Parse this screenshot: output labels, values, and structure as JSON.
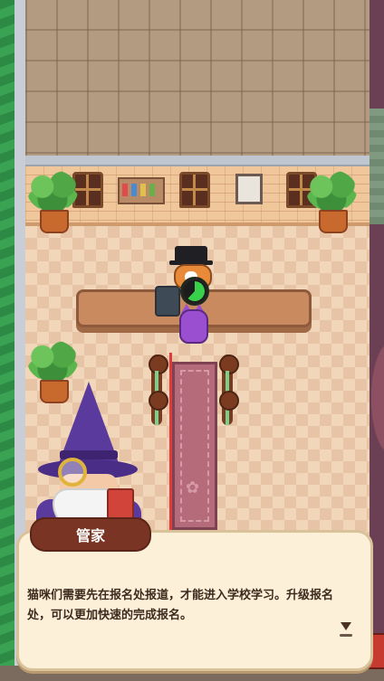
{
  "scene": {
    "type": "reception-hall",
    "progress_fraction": 0.62
  },
  "dialog": {
    "speaker_name": "管家",
    "message": "猫咪们需要先在报名处报道，才能进入学校学习。升级报名处，可以更加快速的完成报名。"
  },
  "icons": {
    "next": "triangle-down-icon",
    "paw": "paw-icon",
    "monocle": "monocle-icon"
  },
  "colors": {
    "guide_arrow": "#e03b3b",
    "progress_fill": "#3ad14a",
    "dialog_bg": "#fcf0d8",
    "name_tag_bg": "#7a3424"
  }
}
